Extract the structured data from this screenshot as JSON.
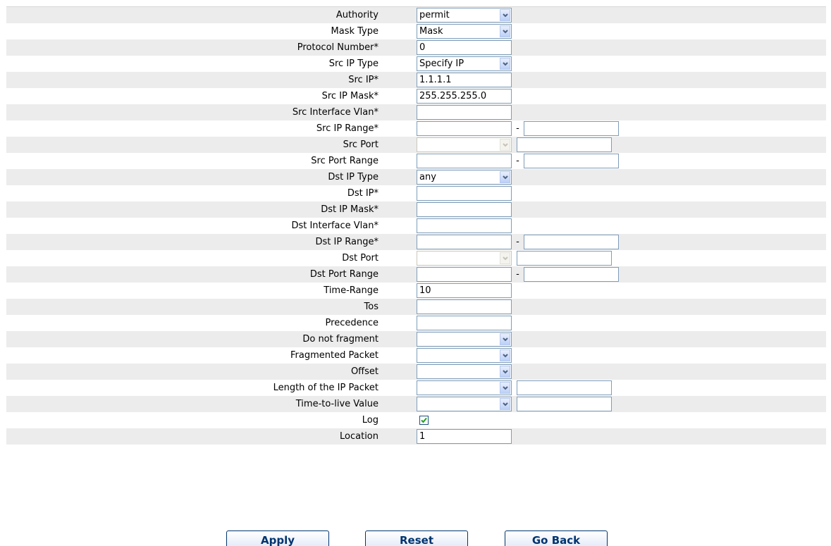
{
  "rows": [
    {
      "label": "Authority",
      "kind": "select",
      "value": "permit"
    },
    {
      "label": "Mask Type",
      "kind": "select",
      "value": "Mask"
    },
    {
      "label": "Protocol Number*",
      "kind": "input",
      "value": "0"
    },
    {
      "label": "Src IP Type",
      "kind": "select",
      "value": "Specify IP"
    },
    {
      "label": "Src IP*",
      "kind": "input",
      "value": "1.1.1.1"
    },
    {
      "label": "Src IP Mask*",
      "kind": "input",
      "value": "255.255.255.0"
    },
    {
      "label": "Src Interface Vlan*",
      "kind": "input",
      "value": ""
    },
    {
      "label": "Src IP Range*",
      "kind": "range",
      "value": "",
      "value2": "",
      "separator": "-"
    },
    {
      "label": "Src Port",
      "kind": "select-input",
      "value": "",
      "value2": "",
      "disabled": true
    },
    {
      "label": "Src Port Range",
      "kind": "range",
      "value": "",
      "value2": "",
      "separator": "-"
    },
    {
      "label": "Dst IP Type",
      "kind": "select",
      "value": "any"
    },
    {
      "label": "Dst IP*",
      "kind": "input",
      "value": ""
    },
    {
      "label": "Dst IP Mask*",
      "kind": "input",
      "value": ""
    },
    {
      "label": "Dst Interface Vlan*",
      "kind": "input",
      "value": ""
    },
    {
      "label": "Dst IP Range*",
      "kind": "range",
      "value": "",
      "value2": "",
      "separator": "-"
    },
    {
      "label": "Dst Port",
      "kind": "select-input",
      "value": "",
      "value2": "",
      "disabled": true
    },
    {
      "label": "Dst Port Range",
      "kind": "range",
      "value": "",
      "value2": "",
      "separator": "-"
    },
    {
      "label": "Time-Range",
      "kind": "input",
      "value": "10"
    },
    {
      "label": "Tos",
      "kind": "input",
      "value": ""
    },
    {
      "label": "Precedence",
      "kind": "input",
      "value": ""
    },
    {
      "label": "Do not fragment",
      "kind": "select",
      "value": ""
    },
    {
      "label": "Fragmented Packet",
      "kind": "select",
      "value": ""
    },
    {
      "label": "Offset",
      "kind": "select",
      "value": ""
    },
    {
      "label": "Length of the IP Packet",
      "kind": "select-input",
      "value": "",
      "value2": ""
    },
    {
      "label": "Time-to-live Value",
      "kind": "select-input",
      "value": "",
      "value2": ""
    },
    {
      "label": "Log",
      "kind": "checkbox",
      "checked": true
    },
    {
      "label": "Location",
      "kind": "input",
      "value": "1"
    }
  ],
  "buttons": {
    "apply": "Apply",
    "reset": "Reset",
    "go_back": "Go Back"
  },
  "colors": {
    "row_alt": "#ececec",
    "input_border": "#7f9db9",
    "button_text": "#00346f",
    "checkmark": "#21a121"
  }
}
